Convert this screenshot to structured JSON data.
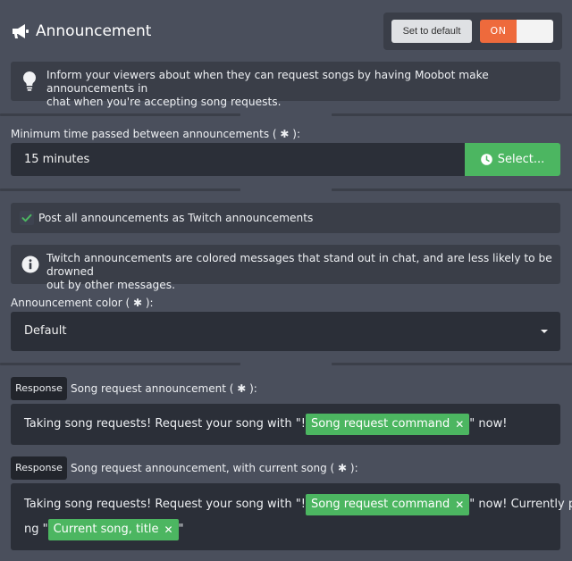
{
  "header": {
    "title": "Announcement",
    "icon": "megaphone-icon",
    "set_default_label": "Set to default",
    "toggle_label": "ON"
  },
  "intro_info": {
    "icon": "lightbulb-icon",
    "text_line1": "Inform your viewers about when they can request songs by having Moobot make announcements in",
    "text_line2": "chat when you're accepting song requests."
  },
  "interval": {
    "label": "Minimum time passed between announcements ( ✱ ):",
    "value": "15 minutes",
    "select_label": "Select...",
    "select_icon": "clock-icon"
  },
  "twitch_option": {
    "checked": true,
    "label": "Post all announcements as Twitch announcements"
  },
  "twitch_info": {
    "icon": "info-icon",
    "text_line1": "Twitch announcements are colored messages that stand out in chat, and are less likely to be drowned",
    "text_line2": "out by other messages."
  },
  "color": {
    "label": "Announcement color ( ✱ ):",
    "value": "Default"
  },
  "responses": [
    {
      "badge": "Response",
      "label": "Song request announcement ( ✱ ):",
      "line1_before": "Taking song requests! Request your song with \"!",
      "tag1": "Song request command",
      "line1_after": "\" now!"
    },
    {
      "badge": "Response",
      "label": "Song request announcement, with current song ( ✱ ):",
      "line1_before": "Taking song requests! Request your song with \"!",
      "tag1": "Song request command",
      "line1_after": "\" now! Currently playi",
      "line2_before": "ng \"",
      "tag2": "Current song, title",
      "line2_after": "\""
    }
  ],
  "colors": {
    "accent_green": "#4cb661",
    "toggle_on": "#ee6a3c",
    "background": "#4a4f5c",
    "field_bg": "#2b2f38"
  }
}
